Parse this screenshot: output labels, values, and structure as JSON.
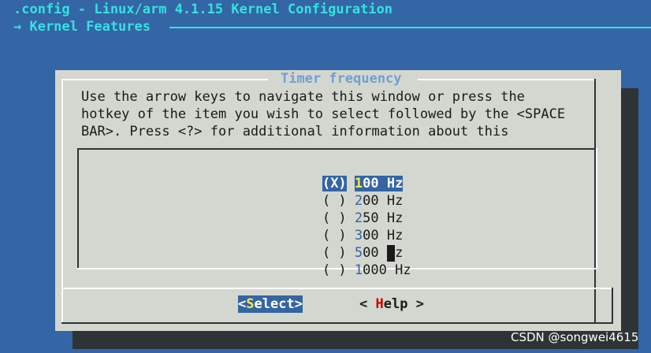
{
  "header": {
    "title": ".config - Linux/arm 4.1.15 Kernel Configuration",
    "breadcrumb": "→ Kernel Features"
  },
  "dialog": {
    "title": "Timer frequency",
    "description": [
      "Use the arrow keys to navigate this window or press the",
      "hotkey of the item you wish to select followed by the <SPACE",
      "BAR>. Press <?> for additional information about this"
    ],
    "options": [
      {
        "mark": "(X)",
        "hotkey": "1",
        "rest": "00 Hz",
        "selected": true
      },
      {
        "mark": "( )",
        "hotkey": "2",
        "rest": "00 Hz",
        "selected": false
      },
      {
        "mark": "( )",
        "hotkey": "2",
        "rest": "50 Hz",
        "selected": false
      },
      {
        "mark": "( )",
        "hotkey": "3",
        "rest": "00 Hz",
        "selected": false
      },
      {
        "mark": "( )",
        "hotkey": "5",
        "rest": "00 Hz",
        "selected": false
      },
      {
        "mark": "( )",
        "hotkey": "1",
        "rest": "000 Hz",
        "selected": false
      }
    ],
    "buttons": {
      "select": {
        "open": "<",
        "hotkey": "S",
        "rest": "elect",
        "close": ">"
      },
      "help": {
        "open": "< ",
        "hotkey": "H",
        "rest": "elp",
        "close": " >"
      }
    }
  },
  "watermark": "CSDN @songwei4615",
  "colors": {
    "background": "#3465a4",
    "header_text": "#34e2e2",
    "dialog_bg": "#d3d7cf",
    "dialog_title": "#729fcf",
    "highlight": "#3465a4",
    "select_hotkey": "#fce94f",
    "help_hotkey": "#cc0000"
  }
}
